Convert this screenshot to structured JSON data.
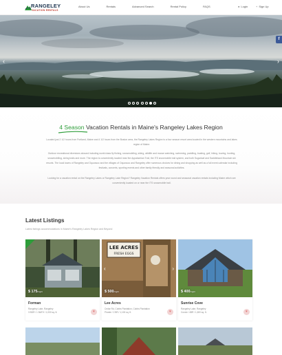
{
  "header": {
    "logo": {
      "title": "RANGELEY",
      "subtitle": "VACATION RENTALS"
    },
    "nav": [
      "About Us",
      "Rentals",
      "Advanced Search",
      "Rental Policy",
      "FAQS"
    ],
    "login": "Login",
    "signup": "Sign Up"
  },
  "hero": {
    "slide_count": 7,
    "active_slide": 6,
    "facebook": "f"
  },
  "intro": {
    "title_highlight": "4 Season",
    "title_rest": " Vacation Rentals in Maine's Rangeley Lakes Region",
    "paragraphs": [
      "Located just 2 1/2 hours from Portland, Maine and 4 1/2 hours from the Boston area, the Rangeley Lakes Region is a four season resort area located in the western mountains and lakes region of Maine.",
      "Outdoor recreational diversions abound including world class fly fishing, snowmobiling, skiing, wildlife and moose watching, swimming, paddling, boating, golf, hiking, touring, hunting, snowmobiling, skiing trails and more. The region is conveniently located near the Appalachian Trail, the ITS snowmobile trail system, and both Sugarloaf and Saddleback Mountain ski resorts. The local towns of Rangeley and Oquossoc and the villages of Oquossoc and Rangeley offer numerous choices for dining and shopping as well as a full event calendar including festivals, concerts, sporting events and other family friendly and seasonal activities.",
      "Looking for a vacation rental on the Rangeley Lakes or Rangeley Lake Region? Rangeley Vacation Rentals offers year round and seasonal vacation rentals including Maine which are conveniently located on or near the ITS snowmobile trail."
    ]
  },
  "listings": {
    "title": "Latest Listings",
    "subtitle": "Latest listings accommodations in Maine's Rangeley Lakes Region and Beyond",
    "cards": [
      {
        "name": "Forman",
        "price": "$ 175",
        "unit": "/night",
        "location": "Rangeley Lake, Rangeley",
        "meta": "3 BDR / 1 BATH / 1,000 sq. ft."
      },
      {
        "name": "Lee Acres",
        "price": "$ 500",
        "unit": "/night",
        "location": "Cedar Rd, Cobbs Plantation, Cobbs Plantation",
        "meta": "Private / 2 BR / 1,100 sq. ft."
      },
      {
        "name": "Sunrise Cove",
        "price": "$ 400",
        "unit": "/night",
        "location": "Rangeley Lake, Rangeley",
        "meta": "Condo / 4BR / 1,600 sq. ft."
      }
    ]
  },
  "colors": {
    "accent_green": "#2e9d3a",
    "brand_navy": "#1e3550",
    "heart_pink": "#e17b7b"
  }
}
